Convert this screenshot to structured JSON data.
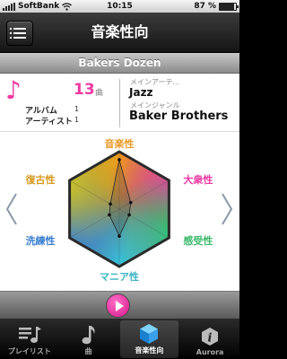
{
  "status_bar": {
    "carrier": "SoftBank",
    "time": "10:15",
    "battery": "87 %",
    "battery_level": 0.87
  },
  "nav": {
    "title": "音楽性向"
  },
  "album": {
    "title": "Bakers Dozen"
  },
  "info": {
    "song_count": "13",
    "song_unit": "曲",
    "album_label": "アルバム",
    "album_count": "1",
    "artist_label": "アーティスト",
    "artist_count": "1",
    "main_artist_label": "メインアーテ...",
    "main_artist": "Jazz",
    "main_genre_label": "メインジャンル",
    "main_genre": "Baker Brothers"
  },
  "chart_data": {
    "type": "radar",
    "axes": [
      "音楽性",
      "大衆性",
      "感受性",
      "マニア性",
      "洗練性",
      "復古性"
    ],
    "values": [
      0.86,
      0.23,
      0.2,
      0.47,
      0.2,
      0.18
    ],
    "axis_colors": [
      "#e89a2a",
      "#ef3aa3",
      "#3cba6a",
      "#3ab5c6",
      "#3a7fd0",
      "#d79a20"
    ]
  },
  "tabs": [
    {
      "label": "プレイリスト",
      "icon": "playlist-icon"
    },
    {
      "label": "曲",
      "icon": "music-note-icon"
    },
    {
      "label": "音楽性向",
      "icon": "cube-icon",
      "active": true
    },
    {
      "label": "Aurora",
      "icon": "info-icon"
    }
  ],
  "colors": {
    "accent": "#ef3aa3",
    "navbar": "#222222"
  }
}
